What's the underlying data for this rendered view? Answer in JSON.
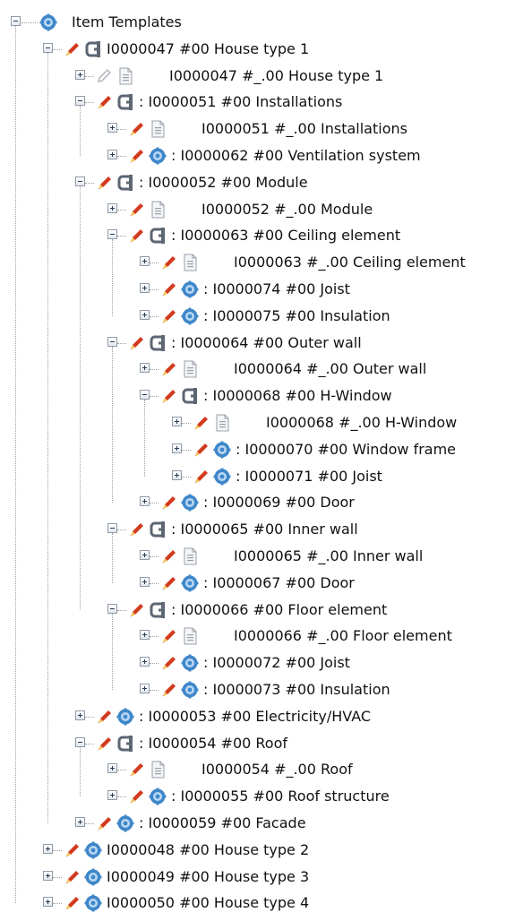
{
  "root": {
    "label": "Item Templates",
    "icon": "gear-icon"
  },
  "rows": [
    {
      "depth": 1,
      "toggle": "minus",
      "pencil": true,
      "pencil_disabled": false,
      "icon": "clamp-icon",
      "label": "I0000047 #00 House type 1",
      "gap": false
    },
    {
      "depth": 2,
      "toggle": "plus",
      "pencil": true,
      "pencil_disabled": true,
      "icon": "document-icon",
      "label": "I0000047 #_.00 House type 1",
      "gap": true
    },
    {
      "depth": 2,
      "toggle": "minus",
      "pencil": true,
      "pencil_disabled": false,
      "icon": "clamp-icon",
      "label": ": I0000051 #00 Installations",
      "gap": false
    },
    {
      "depth": 3,
      "toggle": "plus",
      "pencil": true,
      "pencil_disabled": false,
      "icon": "document-icon",
      "label": "I0000051 #_.00 Installations",
      "gap": true
    },
    {
      "depth": 3,
      "toggle": "plus",
      "pencil": true,
      "pencil_disabled": false,
      "icon": "gear-icon",
      "label": ": I0000062 #00 Ventilation system",
      "gap": false
    },
    {
      "depth": 2,
      "toggle": "minus",
      "pencil": true,
      "pencil_disabled": false,
      "icon": "clamp-icon",
      "label": ": I0000052 #00 Module",
      "gap": false
    },
    {
      "depth": 3,
      "toggle": "plus",
      "pencil": true,
      "pencil_disabled": false,
      "icon": "document-icon",
      "label": "I0000052 #_.00 Module",
      "gap": true
    },
    {
      "depth": 3,
      "toggle": "minus",
      "pencil": true,
      "pencil_disabled": false,
      "icon": "clamp-icon",
      "label": ": I0000063 #00 Ceiling element",
      "gap": false
    },
    {
      "depth": 4,
      "toggle": "plus",
      "pencil": true,
      "pencil_disabled": false,
      "icon": "document-icon",
      "label": "I0000063 #_.00 Ceiling element",
      "gap": true
    },
    {
      "depth": 4,
      "toggle": "plus",
      "pencil": true,
      "pencil_disabled": false,
      "icon": "gear-icon",
      "label": ": I0000074 #00 Joist",
      "gap": false
    },
    {
      "depth": 4,
      "toggle": "plus",
      "pencil": true,
      "pencil_disabled": false,
      "icon": "gear-icon",
      "label": ": I0000075 #00 Insulation",
      "gap": false
    },
    {
      "depth": 3,
      "toggle": "minus",
      "pencil": true,
      "pencil_disabled": false,
      "icon": "clamp-icon",
      "label": ": I0000064 #00 Outer wall",
      "gap": false
    },
    {
      "depth": 4,
      "toggle": "plus",
      "pencil": true,
      "pencil_disabled": false,
      "icon": "document-icon",
      "label": "I0000064 #_.00 Outer wall",
      "gap": true
    },
    {
      "depth": 4,
      "toggle": "minus",
      "pencil": true,
      "pencil_disabled": false,
      "icon": "clamp-icon",
      "label": ": I0000068 #00 H-Window",
      "gap": false
    },
    {
      "depth": 5,
      "toggle": "plus",
      "pencil": true,
      "pencil_disabled": false,
      "icon": "document-icon",
      "label": "I0000068 #_.00 H-Window",
      "gap": true
    },
    {
      "depth": 5,
      "toggle": "plus",
      "pencil": true,
      "pencil_disabled": false,
      "icon": "gear-icon",
      "label": ": I0000070 #00 Window frame",
      "gap": false
    },
    {
      "depth": 5,
      "toggle": "plus",
      "pencil": true,
      "pencil_disabled": false,
      "icon": "gear-icon",
      "label": ": I0000071 #00 Joist",
      "gap": false
    },
    {
      "depth": 4,
      "toggle": "plus",
      "pencil": true,
      "pencil_disabled": false,
      "icon": "gear-icon",
      "label": ": I0000069 #00 Door",
      "gap": false
    },
    {
      "depth": 3,
      "toggle": "minus",
      "pencil": true,
      "pencil_disabled": false,
      "icon": "clamp-icon",
      "label": ": I0000065 #00 Inner wall",
      "gap": false
    },
    {
      "depth": 4,
      "toggle": "plus",
      "pencil": true,
      "pencil_disabled": false,
      "icon": "document-icon",
      "label": "I0000065 #_.00 Inner wall",
      "gap": true
    },
    {
      "depth": 4,
      "toggle": "plus",
      "pencil": true,
      "pencil_disabled": false,
      "icon": "gear-icon",
      "label": ": I0000067 #00 Door",
      "gap": false
    },
    {
      "depth": 3,
      "toggle": "minus",
      "pencil": true,
      "pencil_disabled": false,
      "icon": "clamp-icon",
      "label": ": I0000066 #00 Floor element",
      "gap": false
    },
    {
      "depth": 4,
      "toggle": "plus",
      "pencil": true,
      "pencil_disabled": false,
      "icon": "document-icon",
      "label": "I0000066 #_.00 Floor element",
      "gap": true
    },
    {
      "depth": 4,
      "toggle": "plus",
      "pencil": true,
      "pencil_disabled": false,
      "icon": "gear-icon",
      "label": ": I0000072 #00 Joist",
      "gap": false
    },
    {
      "depth": 4,
      "toggle": "plus",
      "pencil": true,
      "pencil_disabled": false,
      "icon": "gear-icon",
      "label": ": I0000073 #00 Insulation",
      "gap": false
    },
    {
      "depth": 2,
      "toggle": "plus",
      "pencil": true,
      "pencil_disabled": false,
      "icon": "gear-icon",
      "label": ": I0000053 #00 Electricity/HVAC",
      "gap": false
    },
    {
      "depth": 2,
      "toggle": "minus",
      "pencil": true,
      "pencil_disabled": false,
      "icon": "clamp-icon",
      "label": ": I0000054 #00 Roof",
      "gap": false
    },
    {
      "depth": 3,
      "toggle": "plus",
      "pencil": true,
      "pencil_disabled": false,
      "icon": "document-icon",
      "label": "I0000054 #_.00 Roof",
      "gap": true
    },
    {
      "depth": 3,
      "toggle": "plus",
      "pencil": true,
      "pencil_disabled": false,
      "icon": "gear-icon",
      "label": ": I0000055 #00 Roof structure",
      "gap": false
    },
    {
      "depth": 2,
      "toggle": "plus",
      "pencil": true,
      "pencil_disabled": false,
      "icon": "gear-icon",
      "label": ": I0000059 #00 Facade",
      "gap": false
    },
    {
      "depth": 1,
      "toggle": "plus",
      "pencil": true,
      "pencil_disabled": false,
      "icon": "gear-icon",
      "label": "I0000048 #00 House type 2",
      "gap": false
    },
    {
      "depth": 1,
      "toggle": "plus",
      "pencil": true,
      "pencil_disabled": false,
      "icon": "gear-icon",
      "label": "I0000049 #00 House type 3",
      "gap": false
    },
    {
      "depth": 1,
      "toggle": "plus",
      "pencil": true,
      "pencil_disabled": false,
      "icon": "gear-icon",
      "label": "I0000050 #00 House type 4",
      "gap": false
    }
  ],
  "colors": {
    "pencil_body": "#d23a1e",
    "pencil_tip": "#f2c25c",
    "gear": "#3f87c9",
    "gear_light": "#b9d8f2",
    "clamp": "#5d6673",
    "document": "#9aa0a8",
    "tree_line": "#a0a0a0"
  }
}
